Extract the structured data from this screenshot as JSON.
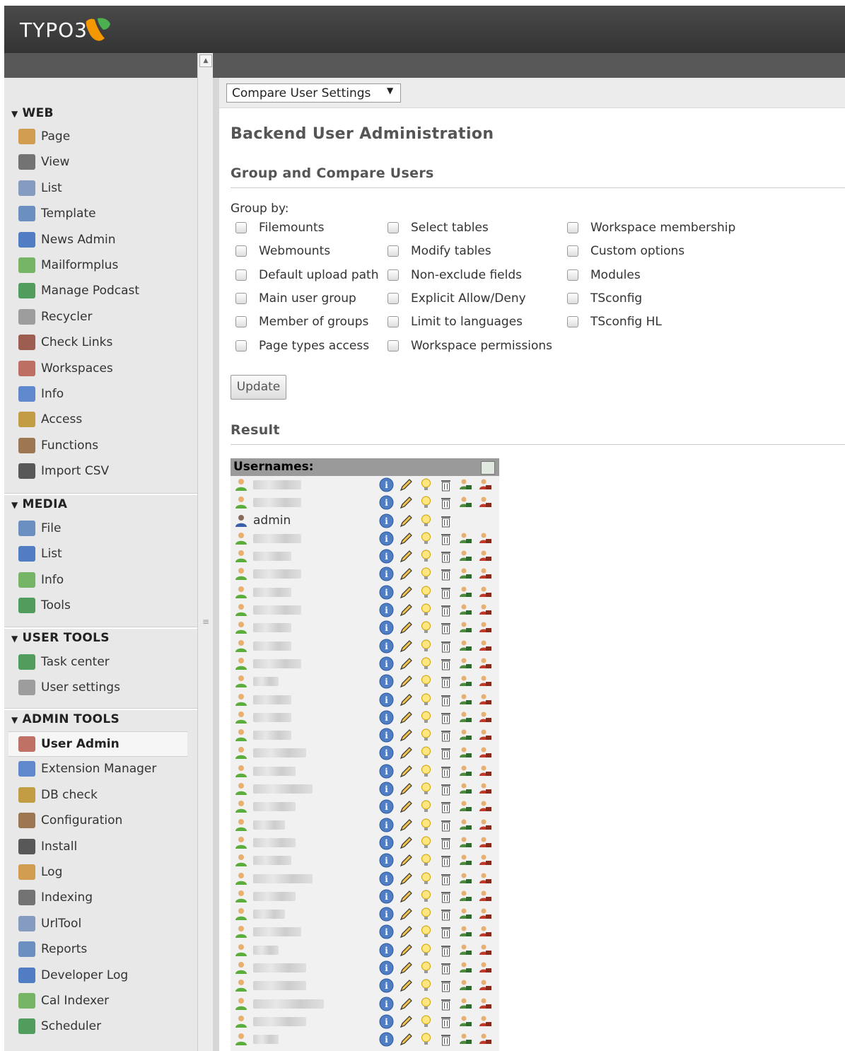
{
  "app": {
    "logo_text": "TYPO3"
  },
  "sidebar": {
    "sections": [
      {
        "title": "WEB",
        "items": [
          "Page",
          "View",
          "List",
          "Template",
          "News Admin",
          "Mailformplus",
          "Manage Podcast",
          "Recycler",
          "Check Links",
          "Workspaces",
          "Info",
          "Access",
          "Functions",
          "Import CSV"
        ]
      },
      {
        "title": "MEDIA",
        "items": [
          "File",
          "List",
          "Info",
          "Tools"
        ]
      },
      {
        "title": "USER TOOLS",
        "items": [
          "Task center",
          "User settings"
        ]
      },
      {
        "title": "ADMIN TOOLS",
        "items": [
          "User Admin",
          "Extension Manager",
          "DB check",
          "Configuration",
          "Install",
          "Log",
          "Indexing",
          "UrlTool",
          "Reports",
          "Developer Log",
          "Cal Indexer",
          "Scheduler"
        ]
      }
    ],
    "active_item": "User Admin"
  },
  "toolbar": {
    "function_menu": "Compare User Settings"
  },
  "main": {
    "title": "Backend User Administration",
    "subtitle": "Group and Compare Users",
    "group_by_label": "Group by:",
    "group_by_columns": [
      [
        "Filemounts",
        "Webmounts",
        "Default upload path",
        "Main user group",
        "Member of groups",
        "Page types access"
      ],
      [
        "Select tables",
        "Modify tables",
        "Non-exclude fields",
        "Explicit Allow/Deny",
        "Limit to languages",
        "Workspace permissions"
      ],
      [
        "Workspace membership",
        "Custom options",
        "Modules",
        "TSconfig",
        "TSconfig HL"
      ]
    ],
    "update_button": "Update",
    "result_title": "Result",
    "result_header": "Usernames:",
    "visible_username": "admin"
  },
  "colors": {
    "topbar": "#3c3c3c",
    "sidebar": "#e8e8e8",
    "header_bar": "#585858",
    "result_header": "#9a9a9a"
  }
}
